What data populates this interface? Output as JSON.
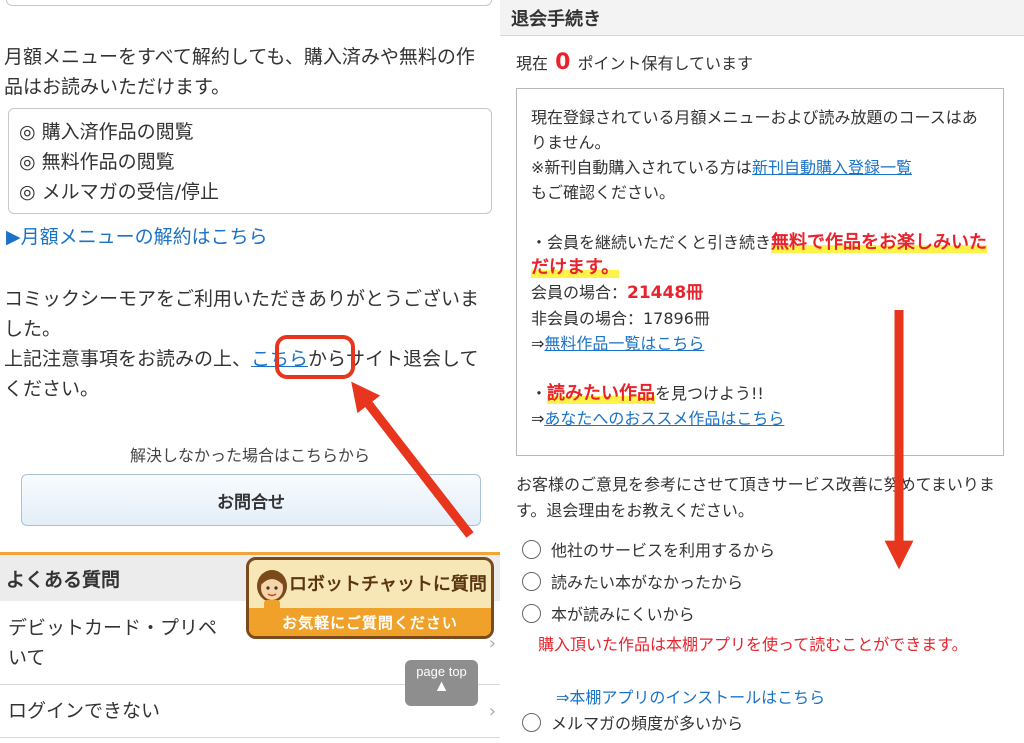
{
  "left": {
    "intro_text": "月額メニューをすべて解約しても、購入済みや無料の作品はお読みいただけます。",
    "benefits": [
      "◎ 購入済作品の閲覧",
      "◎ 無料作品の閲覧",
      "◎ メルマガの受信/停止"
    ],
    "cancel_link": "▶月額メニューの解約はこちら",
    "thanks_line1": "コミックシーモアをご利用いただきありがとうございました。",
    "thanks_line2_pre": "上記注意事項をお読みの上、",
    "thanks_link": "こちら",
    "thanks_line2_post": "からサイト退会してください。",
    "unresolved_text": "解決しなかった場合はこちらから",
    "contact_button": "お問合せ",
    "faq_title": "よくある質問",
    "faq_items": [
      "デビットカード・プリペイドカードについて",
      "ログインできない"
    ],
    "faq_item1_visible_a": "デビットカード・プリペ",
    "faq_item1_visible_b": "いて",
    "chevron": "›",
    "robot_title": "ロボットチャットに質問",
    "robot_sub": "お気軽にご質問ください",
    "page_top": "page top",
    "page_top_arrow": "▲"
  },
  "right": {
    "header": "退会手続き",
    "points_pre": "現在",
    "points_value": "0",
    "points_post": "ポイント保有しています",
    "info_line1": "現在登録されている月額メニューおよび読み放題のコースはありません。",
    "info_line2_pre": "※新刊自動購入されている方は",
    "info_line2_link": "新刊自動購入登録一覧",
    "info_line2_post": "もご確認ください。",
    "member_pre": "・会員を継続いただくと引き続き",
    "member_hl": "無料で作品をお楽しみいただけます。",
    "member_count_label": "会員の場合：",
    "member_count": "21448冊",
    "nonmember_count_label": "非会員の場合：17896冊",
    "free_list_prefix": "⇒",
    "free_list_link": "無料作品一覧はこちら",
    "find_pre": "・",
    "find_hl": "読みたい作品",
    "find_post": "を見つけよう!!",
    "recommend_prefix": "⇒",
    "recommend_link": "あなたへのおススメ作品はこちら",
    "opinion_text": "お客様のご意見を参考にさせて頂きサービス改善に努めてまいります。退会理由をお教えください。",
    "reasons": [
      "他社のサービスを利用するから",
      "読みたい本がなかったから",
      "本が読みにくいから",
      "メルマガの頻度が多いから"
    ],
    "app_note": "購入頂いた作品は本棚アプリを使って読むことができます。",
    "app_link_prefix": "⇒",
    "app_link": "本棚アプリのインストールはこちら"
  },
  "colors": {
    "accent_red": "#e8232d",
    "annotation_red": "#e8361e",
    "link_blue": "#1a73c8",
    "faq_orange": "#f2a33a",
    "highlight_yellow": "#fff34a"
  }
}
